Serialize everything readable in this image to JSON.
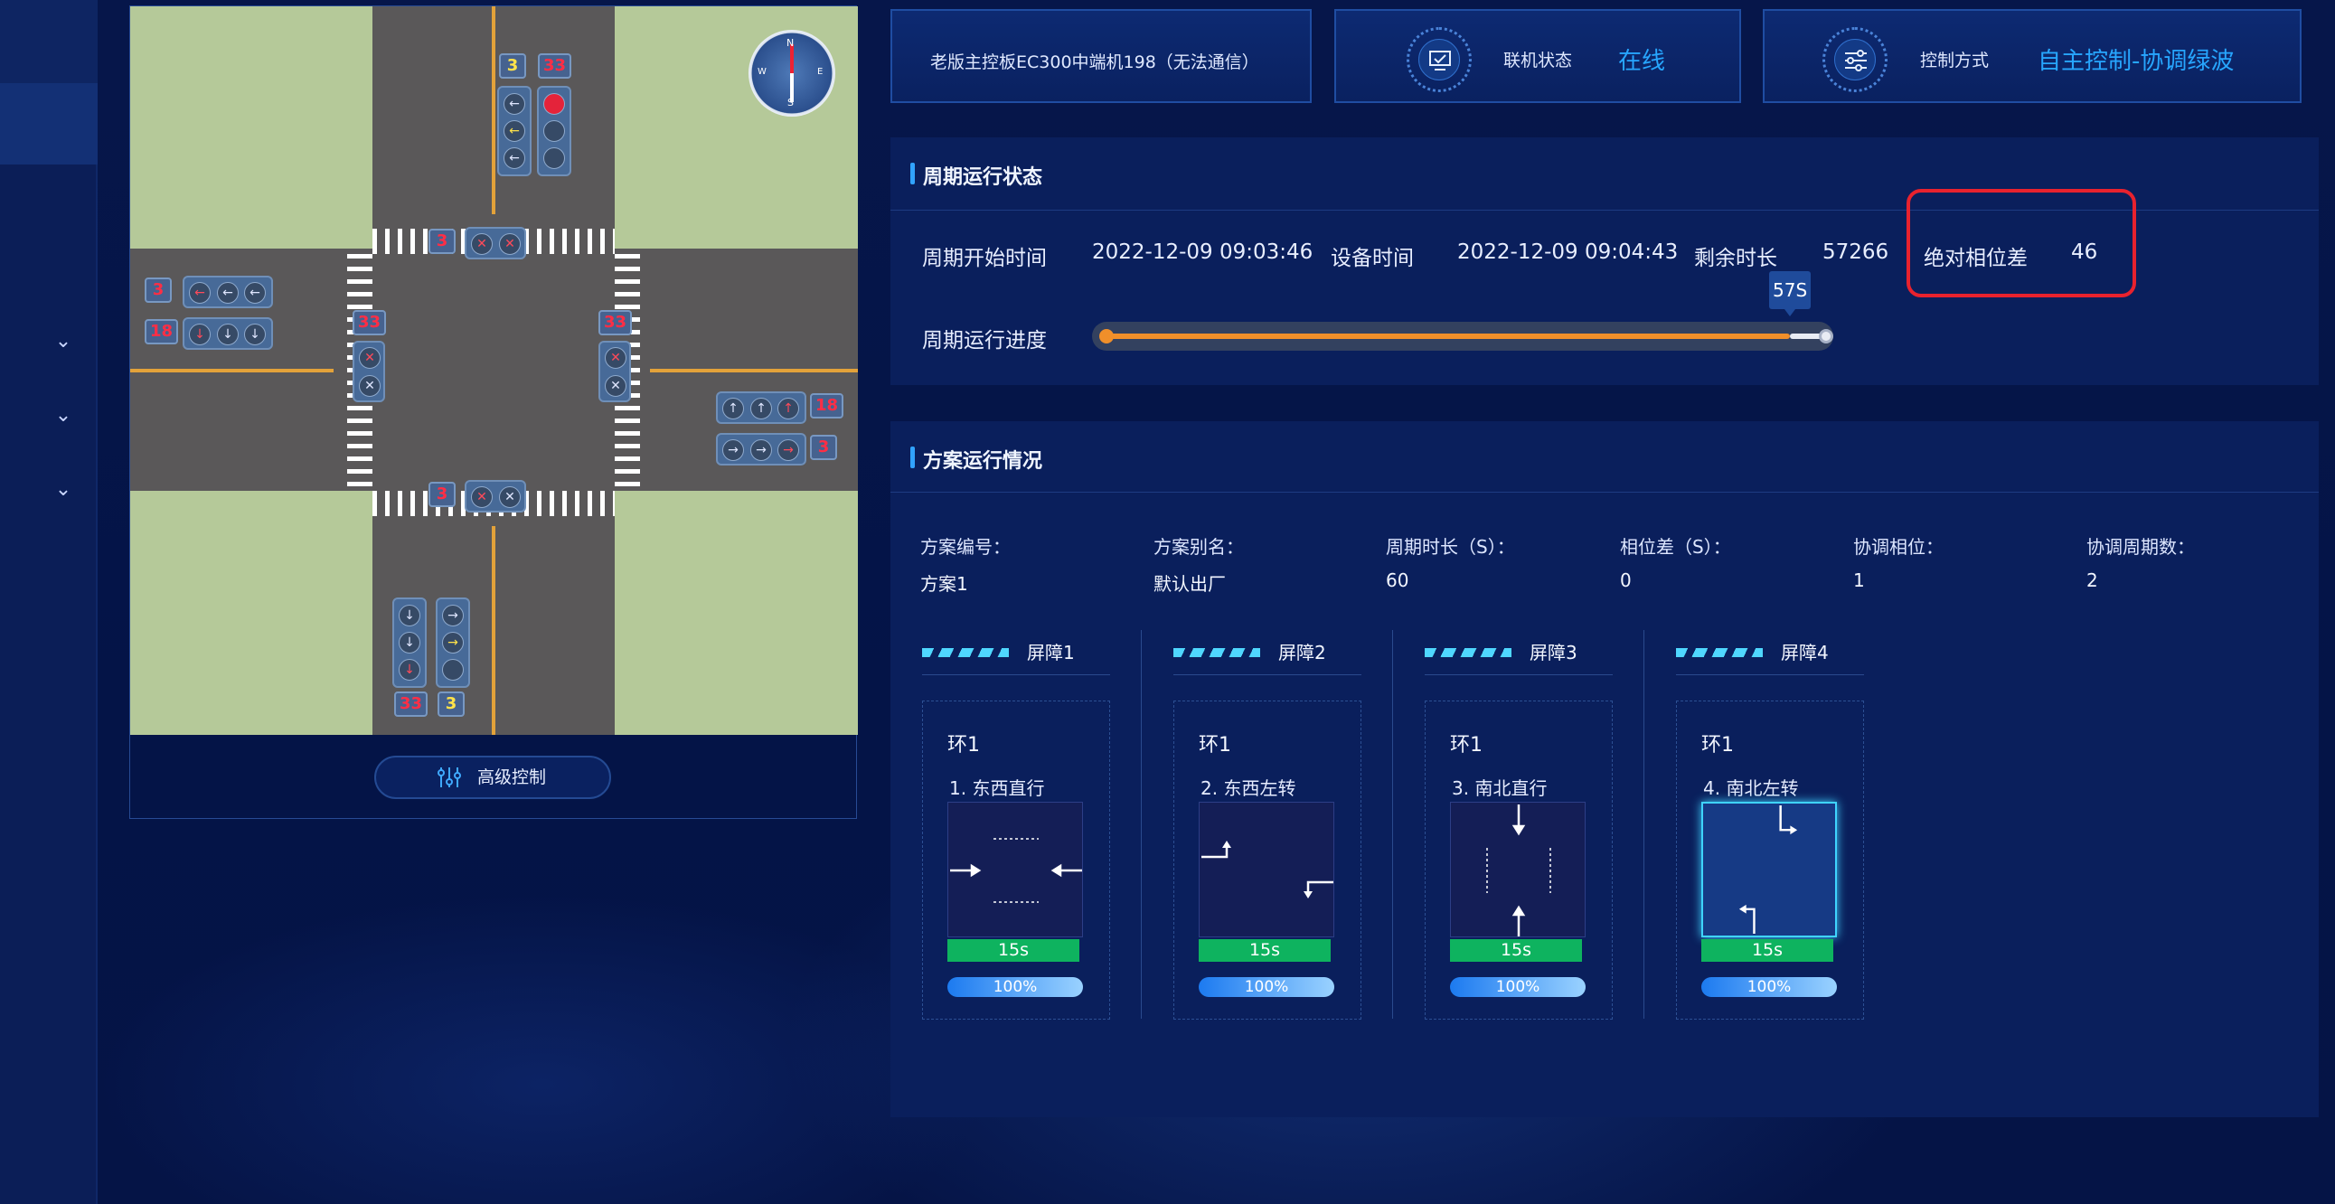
{
  "top_cards": {
    "device_name": "老版主控板EC300中端机198（无法通信）",
    "online_label": "联机状态",
    "online_value": "在线",
    "control_label": "控制方式",
    "control_value": "自主控制-协调绿波"
  },
  "cycle": {
    "title": "周期运行状态",
    "start_label": "周期开始时间",
    "start_value": "2022-12-09 09:03:46",
    "device_time_label": "设备时间",
    "device_time_value": "2022-12-09 09:04:43",
    "remaining_label": "剩余时长",
    "remaining_value": "57266",
    "offset_label": "绝对相位差",
    "offset_value": "46",
    "progress_label": "周期运行进度",
    "progress_tooltip": "57S",
    "progress_fraction": 0.95
  },
  "plan": {
    "title": "方案运行情况",
    "fields": [
      {
        "key": "方案编号：",
        "value": "方案1"
      },
      {
        "key": "方案别名：",
        "value": "默认出厂"
      },
      {
        "key": "周期时长（S）：",
        "value": "60"
      },
      {
        "key": "相位差（S）：",
        "value": "0"
      },
      {
        "key": "协调相位：",
        "value": "1"
      },
      {
        "key": "协调周期数：",
        "value": "2"
      }
    ],
    "barriers": [
      {
        "name": "屏障1",
        "ring": "环1",
        "phase": "1. 东西直行",
        "time": "15s",
        "pct": "100%"
      },
      {
        "name": "屏障2",
        "ring": "环1",
        "phase": "2. 东西左转",
        "time": "15s",
        "pct": "100%"
      },
      {
        "name": "屏障3",
        "ring": "环1",
        "phase": "3. 南北直行",
        "time": "15s",
        "pct": "100%"
      },
      {
        "name": "屏障4",
        "ring": "环1",
        "phase": "4. 南北左转",
        "time": "15s",
        "pct": "100%"
      }
    ]
  },
  "intersection": {
    "advanced_button": "高级控制",
    "counters": {
      "north_yellow": "3",
      "north_red": "33",
      "north_ped": "3",
      "south_ped": "3",
      "west_top": "3",
      "west_bottom": "18",
      "west_ped": "33",
      "east_ped": "33",
      "east_top": "18",
      "east_bottom": "3",
      "south_red": "33",
      "south_yellow": "3"
    },
    "compass": {
      "n": "N",
      "s": "S",
      "w": "W",
      "e": "E"
    }
  },
  "colors": {
    "accent": "#27a6ff",
    "progress": "#f08f2a",
    "highlight": "#e8222e",
    "phase_time": "#0eb35f"
  }
}
